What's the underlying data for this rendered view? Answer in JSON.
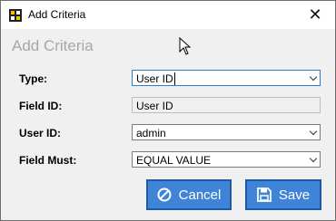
{
  "window": {
    "title": "Add Criteria"
  },
  "heading": "Add Criteria",
  "fields": {
    "type": {
      "label": "Type:",
      "value": "User ID"
    },
    "field_id": {
      "label": "Field ID:",
      "value": "User ID"
    },
    "user_id": {
      "label": "User ID:",
      "value": "admin"
    },
    "field_must": {
      "label": "Field Must:",
      "value": "EQUAL VALUE"
    }
  },
  "buttons": {
    "cancel": "Cancel",
    "save": "Save"
  },
  "colors": {
    "accent": "#3f84d6",
    "accent_border": "#1d5aa7",
    "heading": "#a7a7a7"
  }
}
